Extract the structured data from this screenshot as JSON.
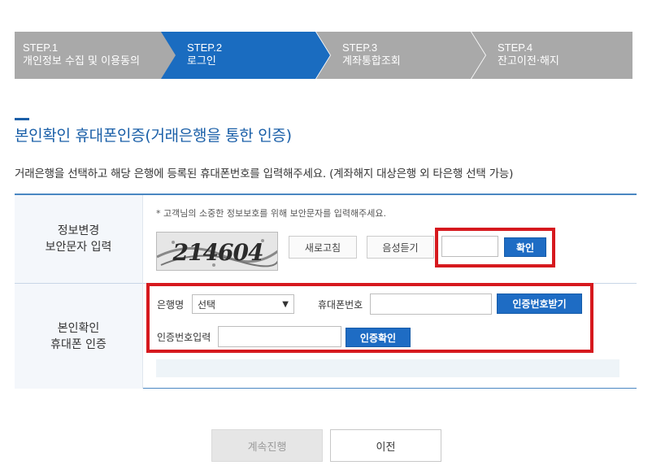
{
  "steps": [
    {
      "num": "STEP.1",
      "label": "개인정보 수집 및 이용동의",
      "active": false
    },
    {
      "num": "STEP.2",
      "label": "로그인",
      "active": true
    },
    {
      "num": "STEP.3",
      "label": "계좌통합조회",
      "active": false
    },
    {
      "num": "STEP.4",
      "label": "잔고이전·해지",
      "active": false
    }
  ],
  "colors": {
    "step_inactive": "#a9a9a9",
    "step_active": "#1a6cc0",
    "accent": "#1a5fa8",
    "button_blue": "#1e6cc4",
    "highlight_red": "#d6191e"
  },
  "page": {
    "title": "본인확인 휴대폰인증(거래은행을 통한 인증)",
    "description": "거래은행을 선택하고 해당 은행에 등록된 휴대폰번호를 입력해주세요. (계좌해지 대상은행 외 타은행 선택 가능)"
  },
  "security": {
    "header_line1": "정보변경",
    "header_line2": "보안문자 입력",
    "note": "* 고객님의 소중한 정보보호를 위해 보안문자를 입력해주세요.",
    "captcha_text": "214604",
    "refresh_label": "새로고침",
    "audio_label": "음성듣기",
    "input_value": "",
    "confirm_label": "확인"
  },
  "phone_auth": {
    "header_line1": "본인확인",
    "header_line2": "휴대폰 인증",
    "bank_label": "은행명",
    "bank_selected": "선택",
    "phone_label": "휴대폰번호",
    "phone_value": "",
    "request_label": "인증번호받기",
    "code_label": "인증번호입력",
    "code_value": "",
    "verify_label": "인증확인"
  },
  "actions": {
    "continue_label": "계속진행",
    "prev_label": "이전"
  }
}
